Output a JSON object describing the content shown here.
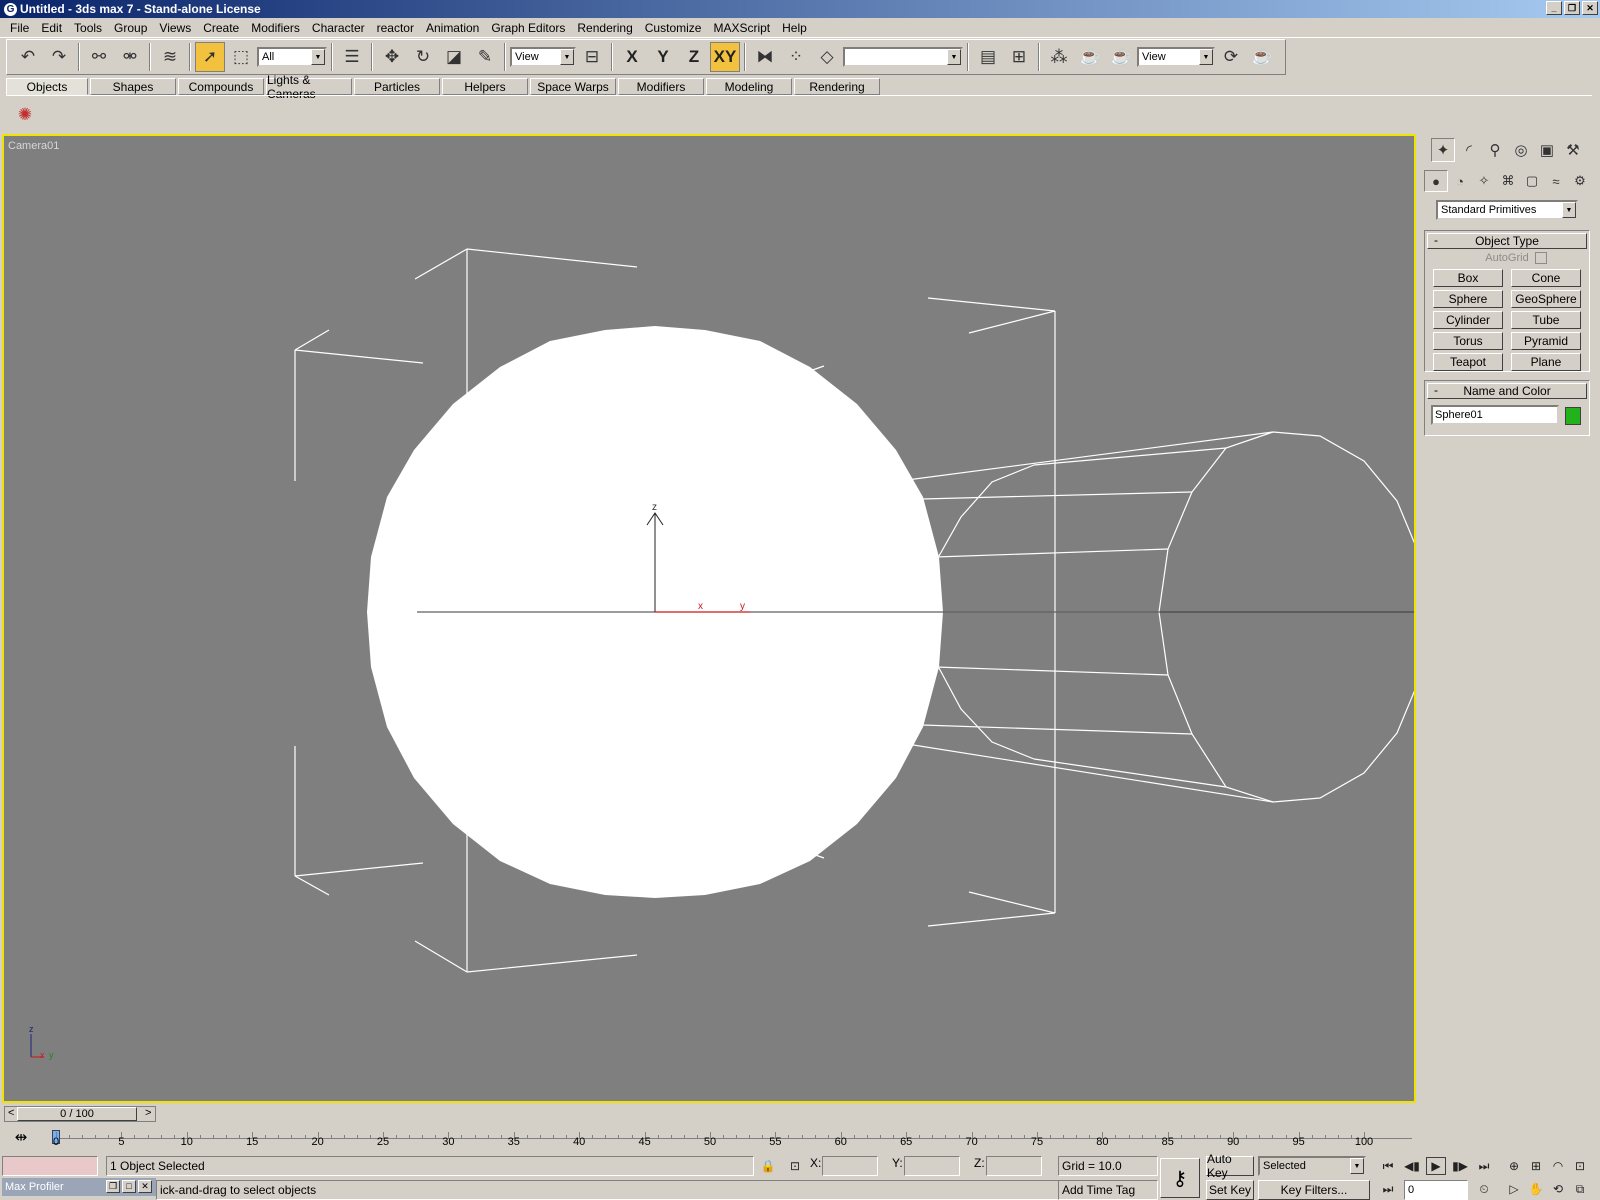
{
  "window": {
    "title": "Untitled - 3ds max 7  - Stand-alone License"
  },
  "menu": [
    "File",
    "Edit",
    "Tools",
    "Group",
    "Views",
    "Create",
    "Modifiers",
    "Character",
    "reactor",
    "Animation",
    "Graph Editors",
    "Rendering",
    "Customize",
    "MAXScript",
    "Help"
  ],
  "toolbar": {
    "selection_filter": "All",
    "ref_coord": "View",
    "axis_x": "X",
    "axis_y": "Y",
    "axis_z": "Z",
    "axis_xy": "XY",
    "named_sel": "",
    "render_type": "View"
  },
  "tabs": [
    "Objects",
    "Shapes",
    "Compounds",
    "Lights & Cameras",
    "Particles",
    "Helpers",
    "Space Warps",
    "Modifiers",
    "Modeling",
    "Rendering"
  ],
  "viewport": {
    "label": "Camera01",
    "gizmo": {
      "z": "z",
      "x": "x",
      "y": "y"
    },
    "triad": {
      "z": "z",
      "x": "x",
      "y": "y"
    }
  },
  "panel": {
    "category": "Standard Primitives",
    "object_type": {
      "header": "Object Type",
      "minus": "-",
      "autogrid": "AutoGrid",
      "buttons": [
        "Box",
        "Cone",
        "Sphere",
        "GeoSphere",
        "Cylinder",
        "Tube",
        "Torus",
        "Pyramid",
        "Teapot",
        "Plane"
      ]
    },
    "name_color": {
      "header": "Name and Color",
      "minus": "-",
      "name": "Sphere01",
      "color": "#22b21c"
    }
  },
  "timeline": {
    "slider": "0 / 100",
    "current_frame": 0,
    "start": 0,
    "end": 100,
    "ticks": [
      "0",
      "5",
      "10",
      "15",
      "20",
      "25",
      "30",
      "35",
      "40",
      "45",
      "50",
      "55",
      "60",
      "65",
      "70",
      "75",
      "80",
      "85",
      "90",
      "95",
      "100"
    ]
  },
  "status": {
    "selection": "1 Object Selected",
    "prompt": "ick-and-drag to select objects",
    "x_label": "X:",
    "y_label": "Y:",
    "z_label": "Z:",
    "grid": "Grid = 10.0",
    "add_time_tag": "Add Time Tag",
    "auto_key": "Auto Key",
    "set_key": "Set Key",
    "key_mode": "Selected",
    "key_filters": "Key Filters...",
    "frame": "0",
    "profiler": "Max Profiler"
  }
}
